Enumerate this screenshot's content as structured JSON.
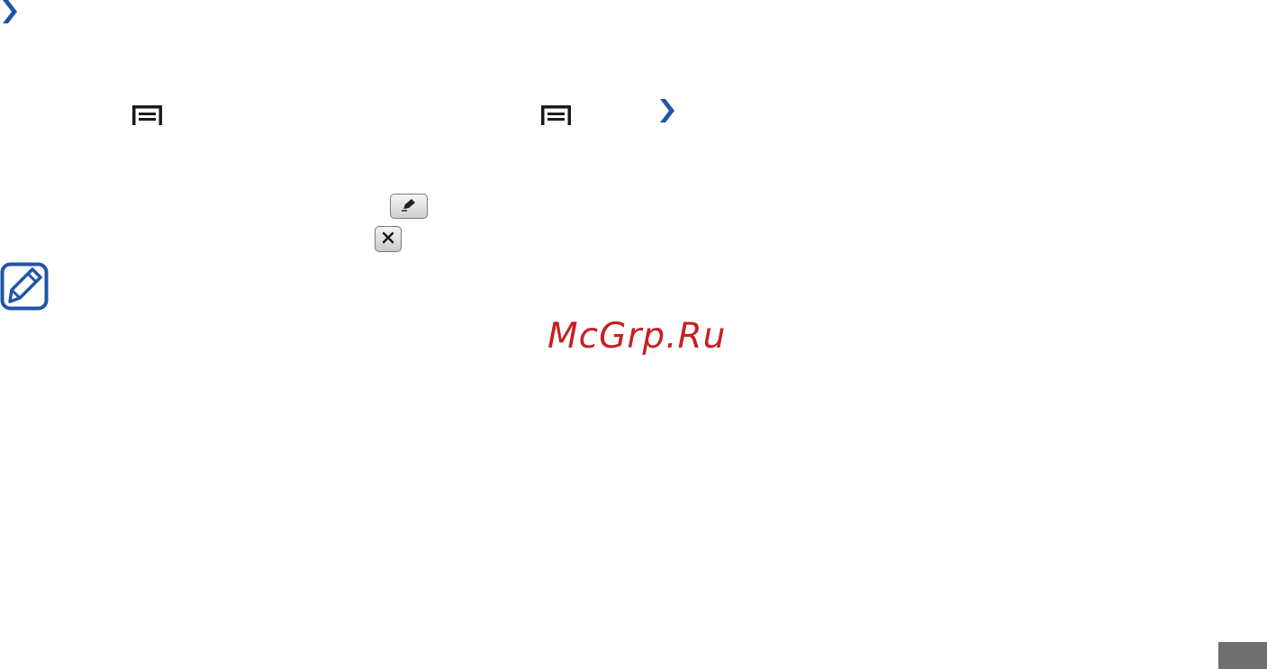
{
  "watermark": {
    "text": "McGrp.Ru"
  },
  "colors": {
    "accent_blue": "#1f55a6",
    "watermark_red": "#c82020",
    "tab_gray": "#6f6f6f"
  },
  "icons": [
    "chevron-right-icon",
    "menu-key-icon",
    "pencil-icon",
    "close-icon",
    "note-icon"
  ]
}
